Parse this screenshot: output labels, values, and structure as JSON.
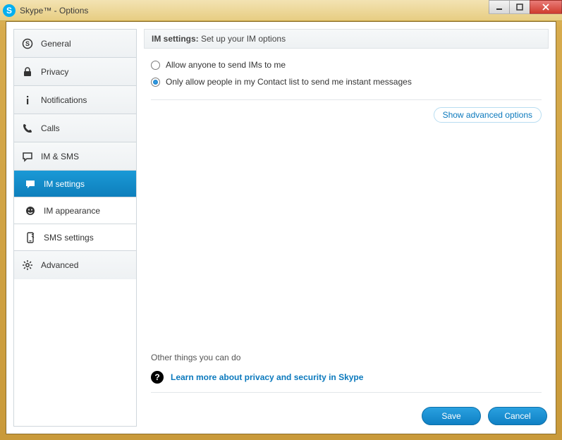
{
  "window": {
    "title": "Skype™ - Options",
    "icon_letter": "S"
  },
  "sidebar": {
    "items": [
      {
        "label": "General",
        "icon": "skype-icon"
      },
      {
        "label": "Privacy",
        "icon": "lock-icon"
      },
      {
        "label": "Notifications",
        "icon": "info-icon"
      },
      {
        "label": "Calls",
        "icon": "phone-icon"
      },
      {
        "label": "IM & SMS",
        "icon": "bubble-icon"
      },
      {
        "label": "IM settings",
        "icon": "chat-icon",
        "sub": true,
        "selected": true
      },
      {
        "label": "IM appearance",
        "icon": "smile-icon",
        "sub": true
      },
      {
        "label": "SMS settings",
        "icon": "sms-icon",
        "sub": true
      },
      {
        "label": "Advanced",
        "icon": "gear-icon"
      }
    ]
  },
  "content": {
    "header_bold": "IM settings:",
    "header_rest": " Set up your IM options",
    "radio": {
      "allow_anyone": "Allow anyone to send IMs to me",
      "only_contacts": "Only allow people in my Contact list to send me instant messages",
      "selected": "only_contacts"
    },
    "advanced_link": "Show advanced options",
    "other_title": "Other things you can do",
    "learn_link": "Learn more about privacy and security in Skype"
  },
  "buttons": {
    "save": "Save",
    "cancel": "Cancel"
  }
}
